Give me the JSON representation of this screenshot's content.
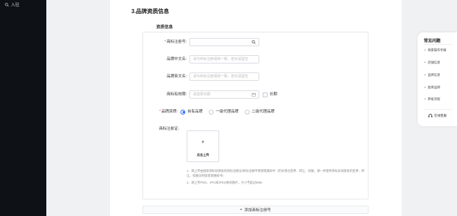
{
  "sidebar": {
    "item_label": "入驻"
  },
  "section": {
    "title": "3.品牌资质信息",
    "subtitle": "资质信息"
  },
  "form": {
    "reg_no": {
      "label": "商标注册号:",
      "required": true,
      "placeholder": ""
    },
    "cn_name": {
      "label": "品牌中文名:",
      "placeholder": "请与商标注册保持一致，若无请留空"
    },
    "en_name": {
      "label": "品牌英文名:",
      "placeholder": "请与商标注册保持一致，若无请留空"
    },
    "valid": {
      "label": "商标有效期:",
      "placeholder": "请选择日期",
      "long_term_label": "长期"
    },
    "qualification": {
      "label": "品牌资质:",
      "required": true,
      "options": [
        "自有品牌",
        "一级代理品牌",
        "二级代理品牌"
      ],
      "selected": "自有品牌"
    },
    "certificate": {
      "label": "商标注册证:",
      "upload_label": "点击上传"
    },
    "tips": [
      "1、请上传由国家商标局颁发的商标注册证/商标注册申请受理通知书（若办理过变更、转让、续展，请一并提供商标总局颁发的变更、转让、续展证明或受理通知书）",
      "2、请上传PNG、JPG或JPEG格式图片，大小不超过5MB"
    ],
    "add_button": "添加商标注册号"
  },
  "faq": {
    "title": "常见问题",
    "items": [
      "商家操作手册",
      "店铺信息",
      "品牌信息",
      "类目品牌",
      "审核流程"
    ],
    "service": "在线客服"
  },
  "colors": {
    "accent": "#2b6cf5",
    "required": "#e34d59",
    "sidebar": "#0e1116"
  }
}
